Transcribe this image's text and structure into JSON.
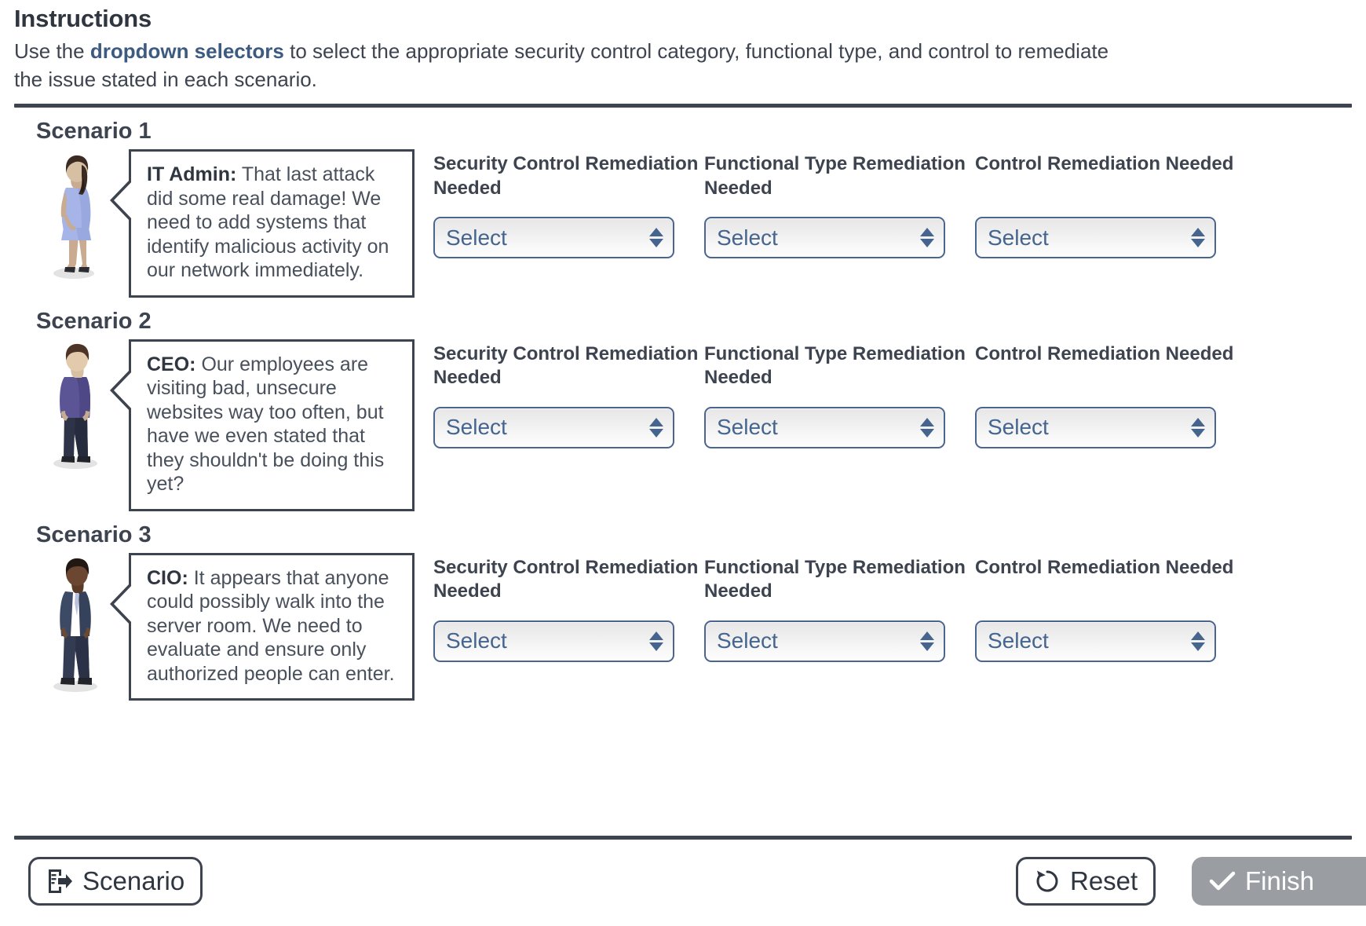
{
  "instructions": {
    "title": "Instructions",
    "body_before": "Use the ",
    "body_highlight": "dropdown selectors",
    "body_after": " to select the appropriate security control category, functional type, and control to remediate the issue stated in each scenario."
  },
  "column_labels": {
    "security_control": "Security Control Remediation Needed",
    "functional_type": "Functional Type Remediation Needed",
    "control": "Control Remediation Needed"
  },
  "select_placeholder": "Select",
  "scenarios": [
    {
      "title": "Scenario 1",
      "speaker": "IT Admin:",
      "quote": " That last attack did some real damage! We need to add systems that identify malicious activity on our network immediately.",
      "avatar": "woman-it-admin-avatar",
      "selects": [
        "Select",
        "Select",
        "Select"
      ]
    },
    {
      "title": "Scenario 2",
      "speaker": "CEO:",
      "quote": " Our employees are visiting bad, unsecure websites way too often, but have we even stated that they shouldn't be doing this yet?",
      "avatar": "man-ceo-avatar",
      "selects": [
        "Select",
        "Select",
        "Select"
      ]
    },
    {
      "title": "Scenario 3",
      "speaker": "CIO:",
      "quote": " It appears that anyone could possibly walk into the server room. We need to evaluate and ensure only authorized people can enter.",
      "avatar": "man-cio-avatar",
      "selects": [
        "Select",
        "Select",
        "Select"
      ]
    }
  ],
  "footer": {
    "scenario_label": "Scenario",
    "reset_label": "Reset",
    "finish_label": "Finish",
    "finish_disabled": true
  },
  "colors": {
    "accent_blue": "#3d5a80",
    "select_border": "#4a6590",
    "select_text": "#45658f",
    "ink": "#3d4450",
    "finish_disabled_bg": "#9a9ea3"
  }
}
